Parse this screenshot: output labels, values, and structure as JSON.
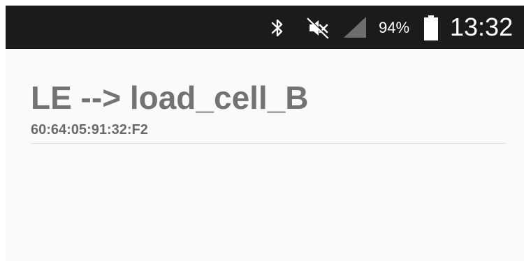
{
  "status_bar": {
    "icons": [
      "bluetooth-icon",
      "mute-icon",
      "signal-icon",
      "battery-icon"
    ],
    "battery_percent": "94%",
    "time": "13:32",
    "background": "#1b1b1b"
  },
  "device": {
    "name": "LE --> load_cell_B",
    "address": "60:64:05:91:32:F2"
  },
  "colors": {
    "screen_background": "#fafafa",
    "name_text": "#737373",
    "address_text": "#6b6b6b",
    "divider": "#dedede"
  }
}
